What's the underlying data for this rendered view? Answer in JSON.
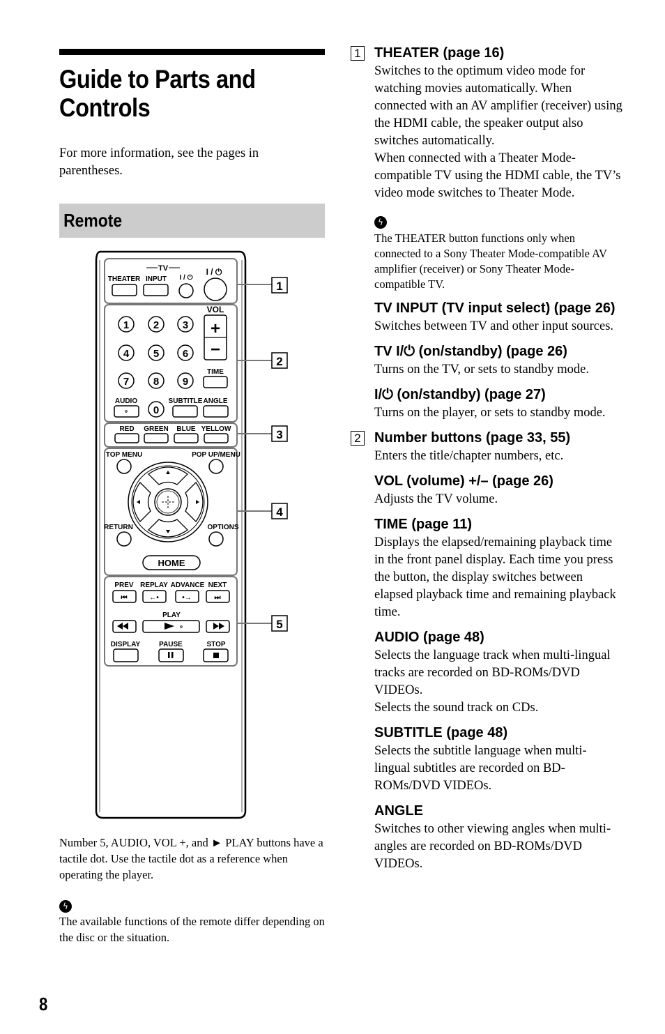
{
  "page": {
    "title": "Guide to Parts and Controls",
    "intro": "For more information, see the pages in parentheses.",
    "section": "Remote",
    "page_number": "8"
  },
  "remote": {
    "tv_group_label": "TV",
    "power_symbol": "I / ⏻",
    "buttons": {
      "theater": "THEATER",
      "input": "INPUT",
      "vol": "VOL",
      "plus": "+",
      "minus": "−",
      "numbers": [
        "1",
        "2",
        "3",
        "4",
        "5",
        "6",
        "7",
        "8",
        "9",
        "0"
      ],
      "time": "TIME",
      "audio": "AUDIO",
      "subtitle": "SUBTITLE",
      "angle": "ANGLE",
      "red": "RED",
      "green": "GREEN",
      "blue": "BLUE",
      "yellow": "YELLOW",
      "top_menu": "TOP MENU",
      "popup_menu": "POP UP/MENU",
      "return": "RETURN",
      "options": "OPTIONS",
      "home": "HOME",
      "prev": "PREV",
      "replay": "REPLAY",
      "advance": "ADVANCE",
      "next": "NEXT",
      "play": "PLAY",
      "display": "DISPLAY",
      "pause": "PAUSE",
      "stop": "STOP"
    },
    "callouts": [
      "1",
      "2",
      "3",
      "4",
      "5"
    ]
  },
  "tactile_note": "Number 5, AUDIO, VOL +, and ► PLAY buttons have a tactile dot. Use the tactile dot as a reference when operating the player.",
  "left_tip": "The available functions of the remote differ depending on the disc or the situation.",
  "tip_icon": "hint-icon",
  "entries": [
    {
      "callout": "1",
      "title": "THEATER (page 16)",
      "text": "Switches to the optimum video mode for watching movies automatically. When connected with an AV amplifier (receiver) using the HDMI cable, the speaker output also switches automatically.",
      "text2": "When connected with a Theater Mode-compatible TV using the HDMI cable, the TV’s video mode switches to Theater Mode."
    },
    {
      "tip": "The THEATER button functions only when connected to a Sony Theater Mode-compatible AV amplifier (receiver) or Sony Theater Mode-compatible TV."
    },
    {
      "title": "TV INPUT (TV input select) (page 26)",
      "text": "Switches between TV and other input sources."
    },
    {
      "title": "TV I/⏻ (on/standby) (page 26)",
      "text": "Turns on the TV, or sets to standby mode."
    },
    {
      "title": "I/⏻ (on/standby) (page 27)",
      "text": "Turns on the player, or sets to standby mode."
    },
    {
      "callout": "2",
      "title": "Number buttons (page 33, 55)",
      "text": "Enters the title/chapter numbers, etc."
    },
    {
      "title": "VOL (volume) +/– (page 26)",
      "text": "Adjusts the TV volume."
    },
    {
      "title": "TIME (page 11)",
      "text": "Displays the elapsed/remaining playback time in the front panel display. Each time you press the button, the display switches between elapsed playback time and remaining playback time."
    },
    {
      "title": "AUDIO (page 48)",
      "text": "Selects the language track when multi-lingual tracks are recorded on BD-ROMs/DVD VIDEOs.",
      "text2": "Selects the sound track on CDs."
    },
    {
      "title": "SUBTITLE (page 48)",
      "text": "Selects the subtitle language when multi-lingual subtitles are recorded on BD-ROMs/DVD VIDEOs."
    },
    {
      "title": "ANGLE",
      "text": "Switches to other viewing angles when multi-angles are recorded on BD-ROMs/DVD VIDEOs."
    }
  ]
}
